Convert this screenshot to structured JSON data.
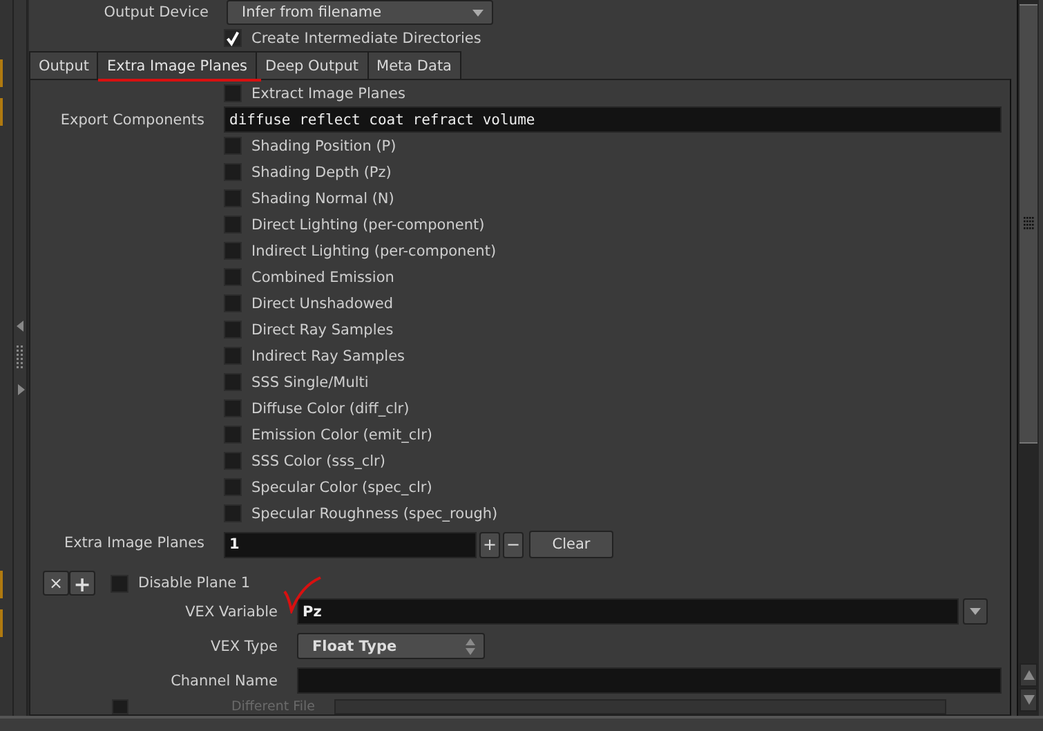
{
  "output_device": {
    "label": "Output Device",
    "value": "Infer from filename"
  },
  "create_dirs": {
    "label": "Create Intermediate Directories",
    "checked": true
  },
  "tabs": [
    {
      "label": "Output",
      "selected": false
    },
    {
      "label": "Extra Image Planes",
      "selected": true
    },
    {
      "label": "Deep Output",
      "selected": false
    },
    {
      "label": "Meta Data",
      "selected": false
    }
  ],
  "extract": {
    "label": "Extract Image Planes",
    "checked": false
  },
  "export_components": {
    "label": "Export Components",
    "value": "diffuse reflect coat refract volume"
  },
  "planes": [
    {
      "label": "Shading Position (P)",
      "checked": false
    },
    {
      "label": "Shading Depth (Pz)",
      "checked": false
    },
    {
      "label": "Shading Normal (N)",
      "checked": false
    },
    {
      "label": "Direct Lighting (per-component)",
      "checked": false
    },
    {
      "label": "Indirect Lighting (per-component)",
      "checked": false
    },
    {
      "label": "Combined Emission",
      "checked": false
    },
    {
      "label": "Direct Unshadowed",
      "checked": false
    },
    {
      "label": "Direct Ray Samples",
      "checked": false
    },
    {
      "label": "Indirect Ray Samples",
      "checked": false
    },
    {
      "label": "SSS Single/Multi",
      "checked": false
    },
    {
      "label": "Diffuse Color (diff_clr)",
      "checked": false
    },
    {
      "label": "Emission Color (emit_clr)",
      "checked": false
    },
    {
      "label": "SSS Color (sss_clr)",
      "checked": false
    },
    {
      "label": "Specular Color (spec_clr)",
      "checked": false
    },
    {
      "label": "Specular Roughness (spec_rough)",
      "checked": false
    }
  ],
  "extra_image_planes": {
    "label": "Extra Image Planes",
    "value": "1",
    "increment": "+",
    "decrement": "−",
    "clear": "Clear"
  },
  "plane_buttons": {
    "remove": "×",
    "add": "+"
  },
  "plane": {
    "disable": {
      "label": "Disable Plane 1",
      "checked": false
    },
    "vex_variable": {
      "label": "VEX Variable",
      "value": "Pz"
    },
    "vex_type": {
      "label": "VEX Type",
      "value": "Float Type"
    },
    "channel_name": {
      "label": "Channel Name"
    },
    "different_file": {
      "label": "Different File",
      "checked": false,
      "disabled": true
    }
  }
}
